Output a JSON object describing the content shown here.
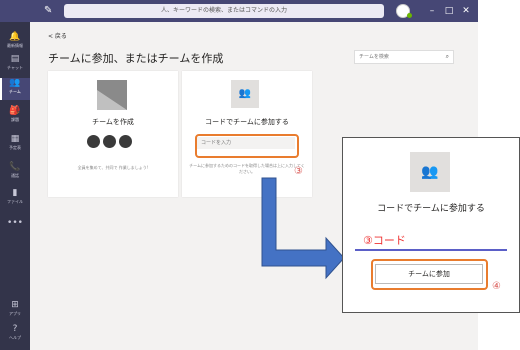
{
  "titlebar": {
    "search_placeholder": "人、キーワードの検索、またはコマンドの入力",
    "minimize": "–",
    "maximize": "□",
    "close": "✕"
  },
  "sidebar": {
    "items": [
      {
        "icon": "bell-icon",
        "glyph": "🔔",
        "label": "最新情報"
      },
      {
        "icon": "chat-icon",
        "glyph": "▤",
        "label": "チャット"
      },
      {
        "icon": "teams-icon",
        "glyph": "👥",
        "label": "チーム"
      },
      {
        "icon": "assignments-icon",
        "glyph": "🎒",
        "label": "課題"
      },
      {
        "icon": "calendar-icon",
        "glyph": "▦",
        "label": "予定表"
      },
      {
        "icon": "phone-icon",
        "glyph": "📞",
        "label": "通話"
      },
      {
        "icon": "file-icon",
        "glyph": "▮",
        "label": "ファイル"
      },
      {
        "icon": "more-icon",
        "glyph": "•••",
        "label": ""
      },
      {
        "icon": "apps-icon",
        "glyph": "⊞",
        "label": "アプリ"
      },
      {
        "icon": "help-icon",
        "glyph": "?",
        "label": "ヘルプ"
      }
    ]
  },
  "main": {
    "back_label": "< 戻る",
    "title": "チームに参加、またはチームを作成",
    "search_placeholder": "チームを検索",
    "create_card": {
      "title": "チームを作成",
      "description": "全員を集めて、共同で 作業しましょう!"
    },
    "join_card": {
      "title": "コードでチームに参加する",
      "code_placeholder": "コードを入力",
      "description": "チームに参加するためのコードを取得した場合は上に入力してください。"
    }
  },
  "annotations": {
    "step3": "③",
    "step4": "④",
    "highlight_color": "#e97c2e",
    "arrow_color": "#4472c4"
  },
  "zoom": {
    "title": "コードでチームに参加する",
    "code_label": "③コード",
    "join_button": "チームに参加"
  }
}
